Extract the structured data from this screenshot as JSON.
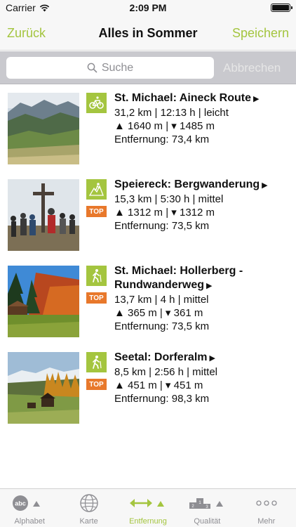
{
  "status_bar": {
    "carrier": "Carrier",
    "time": "2:09 PM"
  },
  "nav": {
    "back_label": "Zurück",
    "title": "Alles in Sommer",
    "save_label": "Speichern"
  },
  "search": {
    "placeholder": "Suche",
    "cancel_label": "Abbrechen"
  },
  "tours": [
    {
      "title": "St. Michael: Aineck Route",
      "stats": "31,2 km | 12:13 h | leicht",
      "elevation": "▲ 1640 m | ▾ 1485 m",
      "distance": "Entfernung: 73,4 km",
      "type_icon": "mountain-bike-icon",
      "top": false
    },
    {
      "title": "Speiereck: Bergwanderung",
      "stats": "15,3 km | 5:30 h | mittel",
      "elevation": "▲ 1312 m | ▾ 1312 m",
      "distance": "Entfernung: 73,5 km",
      "type_icon": "mountain-hike-icon",
      "top": true,
      "top_label": "TOP"
    },
    {
      "title": "St. Michael: Hollerberg - Rundwanderweg",
      "stats": "13,7 km | 4 h | mittel",
      "elevation": "▲ 365 m | ▾ 361 m",
      "distance": "Entfernung: 73,5 km",
      "type_icon": "hiking-icon",
      "top": true,
      "top_label": "TOP"
    },
    {
      "title": "Seetal: Dorferalm",
      "stats": "8,5 km | 2:56 h | mittel",
      "elevation": "▲ 451 m | ▾ 451 m",
      "distance": "Entfernung: 98,3 km",
      "type_icon": "hiking-icon",
      "top": true,
      "top_label": "TOP"
    }
  ],
  "tabs": [
    {
      "label": "Alphabet",
      "icon": "abc-sort-icon",
      "active": false
    },
    {
      "label": "Karte",
      "icon": "globe-icon",
      "active": false
    },
    {
      "label": "Entfernung",
      "icon": "distance-arrows-icon",
      "active": true
    },
    {
      "label": "Qualität",
      "icon": "podium-icon",
      "active": false
    },
    {
      "label": "Mehr",
      "icon": "more-icon",
      "active": false
    }
  ],
  "colors": {
    "accent": "#a4c53f",
    "top_badge": "#e8782b"
  }
}
